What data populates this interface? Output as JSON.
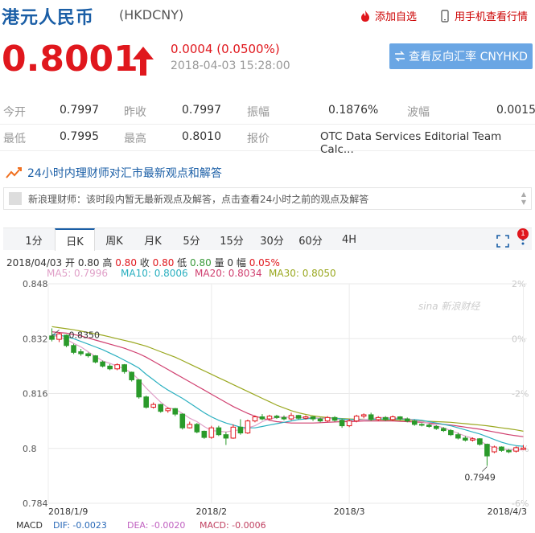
{
  "header": {
    "title": "港元人民币",
    "code": "(HKDCNY)",
    "add_watch": "添加自选",
    "mobile_view": "用手机查看行情"
  },
  "quote": {
    "price": "0.8001",
    "change": "0.0004 (0.0500%)",
    "time": "2018-04-03 15:28:00",
    "reverse_button": "查看反向汇率 CNYHKD"
  },
  "stats": {
    "row1": [
      {
        "label": "今开",
        "value": "0.7997"
      },
      {
        "label": "昨收",
        "value": "0.7997"
      },
      {
        "label": "振幅",
        "value": "0.1876%"
      },
      {
        "label": "波幅",
        "value": "0.0015"
      }
    ],
    "row2": [
      {
        "label": "最低",
        "value": "0.7995"
      },
      {
        "label": "最高",
        "value": "0.8010"
      },
      {
        "label": "报价",
        "value": "OTC Data Services Editorial Team Calc..."
      }
    ]
  },
  "expert": {
    "heading": "24小时内理财师对汇市最新观点和解答",
    "message": "新浪理财师：该时段内暂无最新观点及解答，点击查看24小时之前的观点及解答"
  },
  "tabs": [
    "1分",
    "日K",
    "周K",
    "月K",
    "5分",
    "15分",
    "30分",
    "60分",
    "4H"
  ],
  "active_tab": "日K",
  "tab_badge": "1",
  "kline_info": {
    "date": "2018/04/03",
    "open_label": "开",
    "open": "0.80",
    "high_label": "高",
    "high": "0.80",
    "close_label": "收",
    "close": "0.80",
    "low_label": "低",
    "low": "0.80",
    "vol_label": "量",
    "vol": "0",
    "amp_label": "幅",
    "amp": "0.05%"
  },
  "ma_legend": [
    {
      "label": "MA5: 0.7996",
      "color": "#e0a0c8"
    },
    {
      "label": "MA10: 0.8006",
      "color": "#2bb0c0"
    },
    {
      "label": "MA20: 0.8034",
      "color": "#d04070"
    },
    {
      "label": "MA30: 0.8050",
      "color": "#9aa820"
    }
  ],
  "macd": {
    "label": "MACD",
    "dif": "DIF: -0.0023",
    "dea": "DEA: -0.0020",
    "macd": "MACD: -0.0006"
  },
  "watermark": "sina 新浪财经",
  "colors": {
    "up": "#e0171d",
    "down": "#2a9a2a",
    "blue": "#1a5ea6"
  },
  "chart_data": {
    "type": "candlestick",
    "y_ticks": [
      "0.848",
      "0.832",
      "0.816",
      "0.8",
      "0.784"
    ],
    "y_right_ticks": [
      "2%",
      "0%",
      "-2%",
      "-4%",
      "-6%"
    ],
    "x_ticks": [
      "2018/1/9",
      "2018/2",
      "2018/3",
      "2018/4/3"
    ],
    "ylim": [
      0.784,
      0.848
    ],
    "annotations": [
      {
        "text": "0.8350",
        "value": 0.835
      },
      {
        "text": "0.7949",
        "value": 0.7949
      }
    ],
    "candles": [
      {
        "o": 0.8328,
        "c": 0.8318,
        "h": 0.835,
        "l": 0.8312
      },
      {
        "o": 0.8318,
        "c": 0.8334,
        "h": 0.8338,
        "l": 0.831
      },
      {
        "o": 0.833,
        "c": 0.83,
        "h": 0.8332,
        "l": 0.8295
      },
      {
        "o": 0.83,
        "c": 0.828,
        "h": 0.8305,
        "l": 0.8275
      },
      {
        "o": 0.8282,
        "c": 0.8276,
        "h": 0.829,
        "l": 0.827
      },
      {
        "o": 0.8276,
        "c": 0.827,
        "h": 0.828,
        "l": 0.8265
      },
      {
        "o": 0.827,
        "c": 0.8252,
        "h": 0.8272,
        "l": 0.8248
      },
      {
        "o": 0.8252,
        "c": 0.824,
        "h": 0.8256,
        "l": 0.8236
      },
      {
        "o": 0.824,
        "c": 0.8232,
        "h": 0.8246,
        "l": 0.8228
      },
      {
        "o": 0.8232,
        "c": 0.8244,
        "h": 0.8248,
        "l": 0.8228
      },
      {
        "o": 0.8244,
        "c": 0.8224,
        "h": 0.8246,
        "l": 0.8218
      },
      {
        "o": 0.8222,
        "c": 0.82,
        "h": 0.8224,
        "l": 0.8195
      },
      {
        "o": 0.82,
        "c": 0.815,
        "h": 0.8202,
        "l": 0.8145
      },
      {
        "o": 0.815,
        "c": 0.812,
        "h": 0.8154,
        "l": 0.8116
      },
      {
        "o": 0.812,
        "c": 0.8128,
        "h": 0.8134,
        "l": 0.8116
      },
      {
        "o": 0.8128,
        "c": 0.8108,
        "h": 0.813,
        "l": 0.8104
      },
      {
        "o": 0.811,
        "c": 0.8116,
        "h": 0.812,
        "l": 0.8104
      },
      {
        "o": 0.8116,
        "c": 0.81,
        "h": 0.8118,
        "l": 0.8094
      },
      {
        "o": 0.81,
        "c": 0.806,
        "h": 0.8102,
        "l": 0.8055
      },
      {
        "o": 0.806,
        "c": 0.807,
        "h": 0.8078,
        "l": 0.8058
      },
      {
        "o": 0.807,
        "c": 0.8048,
        "h": 0.8074,
        "l": 0.8044
      },
      {
        "o": 0.805,
        "c": 0.8032,
        "h": 0.8052,
        "l": 0.8028
      },
      {
        "o": 0.8032,
        "c": 0.806,
        "h": 0.8066,
        "l": 0.8028
      },
      {
        "o": 0.806,
        "c": 0.804,
        "h": 0.8066,
        "l": 0.8036
      },
      {
        "o": 0.804,
        "c": 0.803,
        "h": 0.8048,
        "l": 0.801
      },
      {
        "o": 0.803,
        "c": 0.8062,
        "h": 0.807,
        "l": 0.8028
      },
      {
        "o": 0.8062,
        "c": 0.8045,
        "h": 0.8085,
        "l": 0.804
      },
      {
        "o": 0.8045,
        "c": 0.808,
        "h": 0.8084,
        "l": 0.8042
      },
      {
        "o": 0.808,
        "c": 0.8092,
        "h": 0.8096,
        "l": 0.8076
      },
      {
        "o": 0.8092,
        "c": 0.8086,
        "h": 0.81,
        "l": 0.8082
      },
      {
        "o": 0.8086,
        "c": 0.8094,
        "h": 0.8098,
        "l": 0.8082
      },
      {
        "o": 0.8094,
        "c": 0.809,
        "h": 0.8098,
        "l": 0.8086
      },
      {
        "o": 0.809,
        "c": 0.8086,
        "h": 0.8096,
        "l": 0.8082
      },
      {
        "o": 0.8086,
        "c": 0.8096,
        "h": 0.8104,
        "l": 0.8082
      },
      {
        "o": 0.8096,
        "c": 0.8088,
        "h": 0.8098,
        "l": 0.8084
      },
      {
        "o": 0.8088,
        "c": 0.8092,
        "h": 0.8096,
        "l": 0.8084
      },
      {
        "o": 0.8092,
        "c": 0.8086,
        "h": 0.8094,
        "l": 0.808
      },
      {
        "o": 0.8086,
        "c": 0.808,
        "h": 0.809,
        "l": 0.8076
      },
      {
        "o": 0.808,
        "c": 0.809,
        "h": 0.8094,
        "l": 0.8076
      },
      {
        "o": 0.809,
        "c": 0.8082,
        "h": 0.8094,
        "l": 0.8078
      },
      {
        "o": 0.8082,
        "c": 0.8066,
        "h": 0.8086,
        "l": 0.806
      },
      {
        "o": 0.8066,
        "c": 0.808,
        "h": 0.8086,
        "l": 0.8062
      },
      {
        "o": 0.808,
        "c": 0.8094,
        "h": 0.8098,
        "l": 0.8076
      },
      {
        "o": 0.8094,
        "c": 0.8098,
        "h": 0.8102,
        "l": 0.8088
      },
      {
        "o": 0.8098,
        "c": 0.8084,
        "h": 0.8104,
        "l": 0.808
      },
      {
        "o": 0.8084,
        "c": 0.809,
        "h": 0.8094,
        "l": 0.808
      },
      {
        "o": 0.809,
        "c": 0.8084,
        "h": 0.8094,
        "l": 0.808
      },
      {
        "o": 0.8084,
        "c": 0.8092,
        "h": 0.8096,
        "l": 0.808
      },
      {
        "o": 0.8092,
        "c": 0.8086,
        "h": 0.8094,
        "l": 0.8082
      },
      {
        "o": 0.8086,
        "c": 0.808,
        "h": 0.809,
        "l": 0.8076
      },
      {
        "o": 0.808,
        "c": 0.807,
        "h": 0.8084,
        "l": 0.8066
      },
      {
        "o": 0.807,
        "c": 0.8068,
        "h": 0.8074,
        "l": 0.8064
      },
      {
        "o": 0.8068,
        "c": 0.8064,
        "h": 0.8072,
        "l": 0.806
      },
      {
        "o": 0.8064,
        "c": 0.8058,
        "h": 0.8068,
        "l": 0.8054
      },
      {
        "o": 0.8058,
        "c": 0.8052,
        "h": 0.8062,
        "l": 0.8048
      },
      {
        "o": 0.8052,
        "c": 0.804,
        "h": 0.8056,
        "l": 0.8036
      },
      {
        "o": 0.804,
        "c": 0.803,
        "h": 0.8046,
        "l": 0.8026
      },
      {
        "o": 0.803,
        "c": 0.8024,
        "h": 0.8036,
        "l": 0.802
      },
      {
        "o": 0.8024,
        "c": 0.8028,
        "h": 0.8032,
        "l": 0.802
      },
      {
        "o": 0.8028,
        "c": 0.8012,
        "h": 0.803,
        "l": 0.8008
      },
      {
        "o": 0.8012,
        "c": 0.7978,
        "h": 0.8014,
        "l": 0.7949
      },
      {
        "o": 0.799,
        "c": 0.8004,
        "h": 0.8008,
        "l": 0.7986
      },
      {
        "o": 0.8004,
        "c": 0.7994,
        "h": 0.8006,
        "l": 0.799
      },
      {
        "o": 0.7994,
        "c": 0.799,
        "h": 0.7998,
        "l": 0.7986
      },
      {
        "o": 0.7992,
        "c": 0.8002,
        "h": 0.8006,
        "l": 0.7988
      },
      {
        "o": 0.7997,
        "c": 0.8001,
        "h": 0.801,
        "l": 0.7995
      }
    ],
    "ma_lines": [
      {
        "name": "MA5",
        "values": [
          0.833,
          0.8325,
          0.8318,
          0.8306,
          0.8296,
          0.8282,
          0.8268,
          0.8255,
          0.8248,
          0.824,
          0.8232,
          0.822,
          0.82,
          0.8176,
          0.8155,
          0.8135,
          0.8118,
          0.8114,
          0.8102,
          0.8088,
          0.8078,
          0.8064,
          0.8052,
          0.805,
          0.8048,
          0.8052,
          0.8054,
          0.806,
          0.8066,
          0.8078,
          0.8086,
          0.809,
          0.8092,
          0.809,
          0.809,
          0.809,
          0.809,
          0.8088,
          0.8088,
          0.8086,
          0.8082,
          0.808,
          0.8082,
          0.8084,
          0.8086,
          0.809,
          0.809,
          0.8089,
          0.8088,
          0.8086,
          0.8082,
          0.8078,
          0.8072,
          0.8066,
          0.806,
          0.8052,
          0.8044,
          0.8036,
          0.803,
          0.8022,
          0.801,
          0.8002,
          0.7998,
          0.7996,
          0.7996,
          0.7996
        ]
      },
      {
        "name": "MA10",
        "values": [
          0.8332,
          0.833,
          0.8326,
          0.832,
          0.8312,
          0.8304,
          0.8296,
          0.8288,
          0.8278,
          0.8268,
          0.8257,
          0.8246,
          0.8234,
          0.8216,
          0.82,
          0.8184,
          0.817,
          0.8158,
          0.8146,
          0.8132,
          0.8118,
          0.8104,
          0.8092,
          0.8082,
          0.8074,
          0.8068,
          0.8062,
          0.806,
          0.806,
          0.8064,
          0.8068,
          0.8072,
          0.8076,
          0.808,
          0.8084,
          0.8086,
          0.8088,
          0.8088,
          0.8088,
          0.8088,
          0.8086,
          0.8084,
          0.8084,
          0.8084,
          0.8084,
          0.8086,
          0.8086,
          0.8086,
          0.8086,
          0.8085,
          0.8084,
          0.8082,
          0.8078,
          0.8074,
          0.807,
          0.8066,
          0.806,
          0.8054,
          0.8048,
          0.8042,
          0.8034,
          0.8026,
          0.8018,
          0.8012,
          0.8008,
          0.8006
        ]
      },
      {
        "name": "MA20",
        "values": [
          0.834,
          0.8338,
          0.8336,
          0.8332,
          0.8328,
          0.8322,
          0.8316,
          0.831,
          0.8304,
          0.8298,
          0.8292,
          0.8284,
          0.8276,
          0.8266,
          0.8254,
          0.8242,
          0.823,
          0.8218,
          0.8206,
          0.8194,
          0.8182,
          0.817,
          0.8158,
          0.8146,
          0.8134,
          0.8122,
          0.8112,
          0.8102,
          0.8094,
          0.8088,
          0.8082,
          0.8078,
          0.8076,
          0.8074,
          0.8074,
          0.8074,
          0.8074,
          0.8075,
          0.8076,
          0.8077,
          0.8078,
          0.8078,
          0.8079,
          0.808,
          0.808,
          0.808,
          0.808,
          0.808,
          0.8079,
          0.8078,
          0.8077,
          0.8076,
          0.8074,
          0.8072,
          0.807,
          0.8068,
          0.8065,
          0.8062,
          0.8059,
          0.8056,
          0.8052,
          0.8048,
          0.8044,
          0.804,
          0.8037,
          0.8034
        ]
      },
      {
        "name": "MA30",
        "values": [
          0.8355,
          0.8352,
          0.8349,
          0.8346,
          0.8342,
          0.8338,
          0.8334,
          0.833,
          0.8325,
          0.832,
          0.8315,
          0.831,
          0.8304,
          0.8298,
          0.829,
          0.8282,
          0.8274,
          0.8266,
          0.8256,
          0.8246,
          0.8236,
          0.8226,
          0.8216,
          0.8206,
          0.8196,
          0.8186,
          0.8176,
          0.8166,
          0.8156,
          0.8146,
          0.8136,
          0.8126,
          0.8118,
          0.811,
          0.8104,
          0.8099,
          0.8095,
          0.8092,
          0.809,
          0.8088,
          0.8087,
          0.8086,
          0.8085,
          0.8085,
          0.8084,
          0.8084,
          0.8083,
          0.8083,
          0.8082,
          0.8082,
          0.8081,
          0.808,
          0.8079,
          0.8078,
          0.8077,
          0.8076,
          0.8074,
          0.8072,
          0.807,
          0.8068,
          0.8066,
          0.8063,
          0.806,
          0.8057,
          0.8054,
          0.805
        ]
      }
    ]
  }
}
